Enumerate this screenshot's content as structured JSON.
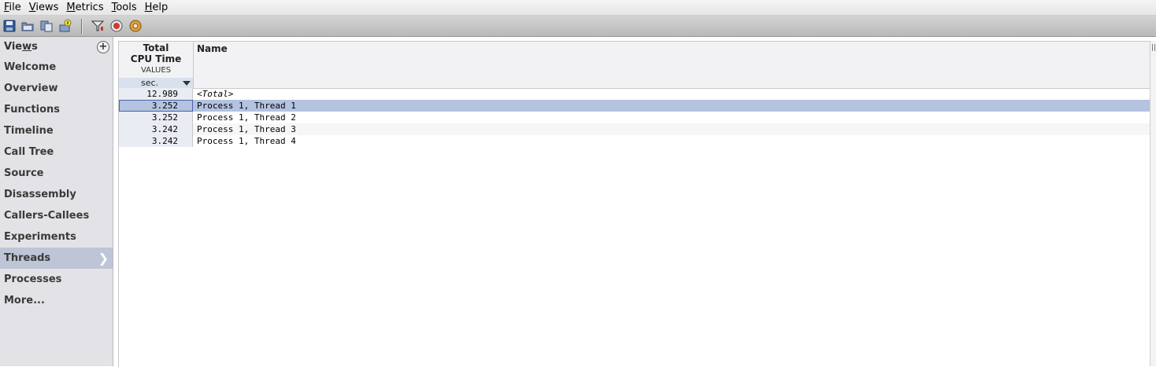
{
  "menu": [
    {
      "mnemonic": "F",
      "rest": "ile"
    },
    {
      "mnemonic": "V",
      "rest": "iews"
    },
    {
      "mnemonic": "M",
      "rest": "etrics"
    },
    {
      "mnemonic": "T",
      "rest": "ools"
    },
    {
      "mnemonic": "H",
      "rest": "elp"
    }
  ],
  "toolbar": {
    "icons": [
      "save-icon",
      "open-icon",
      "compare-icon",
      "connect-icon",
      "filter-icon",
      "record-icon",
      "settings-icon"
    ]
  },
  "sidebar": {
    "title_a": "Vie",
    "title_mn": "w",
    "title_b": "s",
    "add_label": "+",
    "items": [
      "Welcome",
      "Overview",
      "Functions",
      "Timeline",
      "Call Tree",
      "Source",
      "Disassembly",
      "Callers-Callees",
      "Experiments",
      "Threads",
      "Processes",
      "More..."
    ],
    "active_index": 9
  },
  "table": {
    "metric_title_1": "Total",
    "metric_title_2": "CPU Time",
    "metric_sub": "VALUES",
    "metric_unit": "sec.",
    "name_header": "Name",
    "rows": [
      {
        "value": "12.989",
        "name": "<Total>"
      },
      {
        "value": "3.252",
        "name": "Process 1, Thread 1"
      },
      {
        "value": "3.252",
        "name": "Process 1, Thread 2"
      },
      {
        "value": "3.242",
        "name": "Process 1, Thread 3"
      },
      {
        "value": "3.242",
        "name": "Process 1, Thread 4"
      }
    ],
    "selected_row": 1
  }
}
